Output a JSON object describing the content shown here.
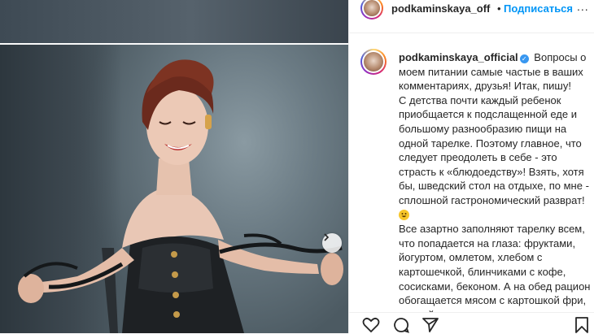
{
  "header": {
    "username": "podkaminskaya_off",
    "separator": "•",
    "follow_label": "Подписаться",
    "more_label": "..."
  },
  "caption": {
    "username": "podkaminskaya_official",
    "paragraph1_text": "Вопросы о моем питании самые частые в ваших комментариях, друзья! Итак, пишу!",
    "paragraph2_text": "С детства почти каждый ребенок приобщается к подслащенной еде и большому разнообразию пищи на одной тарелке. Поэтому главное, что следует преодолеть в себе - это страсть к «блюдоедству»! Взять, хотя бы, шведский стол на отдыхе, по мне - сплошной гастрономический разврат!",
    "paragraph3_text": "Все азартно заполняют тарелку всем, что попадается на глаза: фруктами, йогуртом, омлетом, хлебом с картошечкой, блинчиками с кофе, сосисками, беконом. А на обед рацион обогащается мясом с картошкой фри, пиццей и, конечно"
  },
  "icons": {
    "verified": "verified-badge-icon",
    "emoji": "grinning-face-emoji-icon",
    "next": "chevron-right-icon",
    "like": "heart-icon",
    "comment": "comment-icon",
    "share": "share-icon",
    "save": "bookmark-icon"
  },
  "colors": {
    "link_blue": "#0095f6",
    "verified_blue": "#3897f0",
    "text": "#262626"
  }
}
